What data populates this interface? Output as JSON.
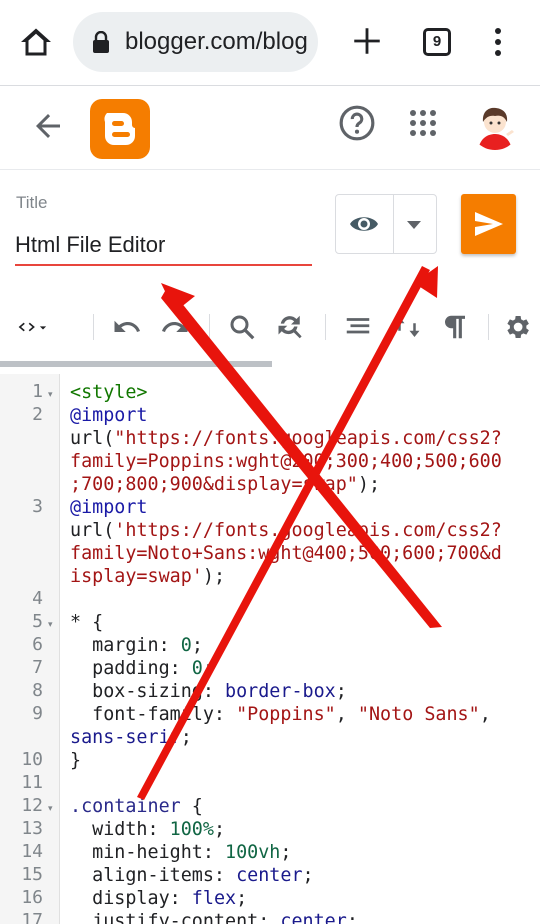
{
  "browser": {
    "url": "blogger.com/blog",
    "tab_count": "9"
  },
  "editor": {
    "title_label": "Title",
    "title_value": "Html File Editor"
  },
  "code_lines": [
    {
      "n": "1",
      "fold": true,
      "parts": [
        [
          "c-tag",
          "<style>"
        ]
      ]
    },
    {
      "n": "2",
      "fold": false,
      "parts": [
        [
          "c-kw",
          "@import"
        ]
      ]
    },
    {
      "n": "",
      "fold": false,
      "parts": [
        [
          "c-plain",
          "url("
        ],
        [
          "c-str",
          "\"https://fonts.googleapis.com/css2?"
        ]
      ]
    },
    {
      "n": "",
      "fold": false,
      "parts": [
        [
          "c-str",
          "family=Poppins:wght@200;300;400;500;600"
        ]
      ]
    },
    {
      "n": "",
      "fold": false,
      "parts": [
        [
          "c-str",
          ";700;800;900&display=swap\""
        ],
        [
          "c-plain",
          ");"
        ]
      ]
    },
    {
      "n": "3",
      "fold": false,
      "parts": [
        [
          "c-kw",
          "@import"
        ]
      ]
    },
    {
      "n": "",
      "fold": false,
      "parts": [
        [
          "c-plain",
          "url("
        ],
        [
          "c-str",
          "'https://fonts.googleapis.com/css2?"
        ]
      ]
    },
    {
      "n": "",
      "fold": false,
      "parts": [
        [
          "c-str",
          "family=Noto+Sans:wght@400;500;600;700&d"
        ]
      ]
    },
    {
      "n": "",
      "fold": false,
      "parts": [
        [
          "c-str",
          "isplay=swap'"
        ],
        [
          "c-plain",
          ");"
        ]
      ]
    },
    {
      "n": "4",
      "fold": false,
      "parts": [
        [
          "c-plain",
          ""
        ]
      ]
    },
    {
      "n": "5",
      "fold": true,
      "parts": [
        [
          "c-plain",
          "* {"
        ]
      ]
    },
    {
      "n": "6",
      "fold": false,
      "parts": [
        [
          "c-plain",
          "  margin: "
        ],
        [
          "c-num",
          "0"
        ],
        [
          "c-plain",
          ";"
        ]
      ]
    },
    {
      "n": "7",
      "fold": false,
      "parts": [
        [
          "c-plain",
          "  padding: "
        ],
        [
          "c-num",
          "0"
        ],
        [
          "c-plain",
          ";"
        ]
      ]
    },
    {
      "n": "8",
      "fold": false,
      "parts": [
        [
          "c-plain",
          "  box-sizing: "
        ],
        [
          "c-val",
          "border-box"
        ],
        [
          "c-plain",
          ";"
        ]
      ]
    },
    {
      "n": "9",
      "fold": false,
      "parts": [
        [
          "c-plain",
          "  font-family: "
        ],
        [
          "c-str",
          "\"Poppins\""
        ],
        [
          "c-plain",
          ", "
        ],
        [
          "c-str",
          "\"Noto Sans\""
        ],
        [
          "c-plain",
          ","
        ]
      ]
    },
    {
      "n": "",
      "fold": false,
      "parts": [
        [
          "c-val",
          "sans-serif"
        ],
        [
          "c-plain",
          ";"
        ]
      ]
    },
    {
      "n": "10",
      "fold": false,
      "parts": [
        [
          "c-plain",
          "}"
        ]
      ]
    },
    {
      "n": "11",
      "fold": false,
      "parts": [
        [
          "c-plain",
          ""
        ]
      ]
    },
    {
      "n": "12",
      "fold": true,
      "parts": [
        [
          "c-sel",
          ".container"
        ],
        [
          "c-plain",
          " {"
        ]
      ]
    },
    {
      "n": "13",
      "fold": false,
      "parts": [
        [
          "c-plain",
          "  width: "
        ],
        [
          "c-num",
          "100%"
        ],
        [
          "c-plain",
          ";"
        ]
      ]
    },
    {
      "n": "14",
      "fold": false,
      "parts": [
        [
          "c-plain",
          "  min-height: "
        ],
        [
          "c-num",
          "100vh"
        ],
        [
          "c-plain",
          ";"
        ]
      ]
    },
    {
      "n": "15",
      "fold": false,
      "parts": [
        [
          "c-plain",
          "  align-items: "
        ],
        [
          "c-val",
          "center"
        ],
        [
          "c-plain",
          ";"
        ]
      ]
    },
    {
      "n": "16",
      "fold": false,
      "parts": [
        [
          "c-plain",
          "  display: "
        ],
        [
          "c-val",
          "flex"
        ],
        [
          "c-plain",
          ";"
        ]
      ]
    },
    {
      "n": "17",
      "fold": false,
      "parts": [
        [
          "c-plain",
          "  justify-content: "
        ],
        [
          "c-val",
          "center"
        ],
        [
          "c-plain",
          ";"
        ]
      ]
    }
  ],
  "colors": {
    "blogger_orange": "#f57d00",
    "annotation_red": "#e8140c",
    "title_underline": "#e8453c"
  },
  "icons": {
    "home": "home-icon",
    "lock": "lock-icon",
    "new_tab": "plus-icon",
    "menu": "more-vert-icon",
    "back": "arrow-back-icon",
    "logo": "blogger-logo",
    "help": "help-icon",
    "apps": "apps-grid-icon",
    "preview": "eye-icon",
    "publish": "send-icon"
  }
}
